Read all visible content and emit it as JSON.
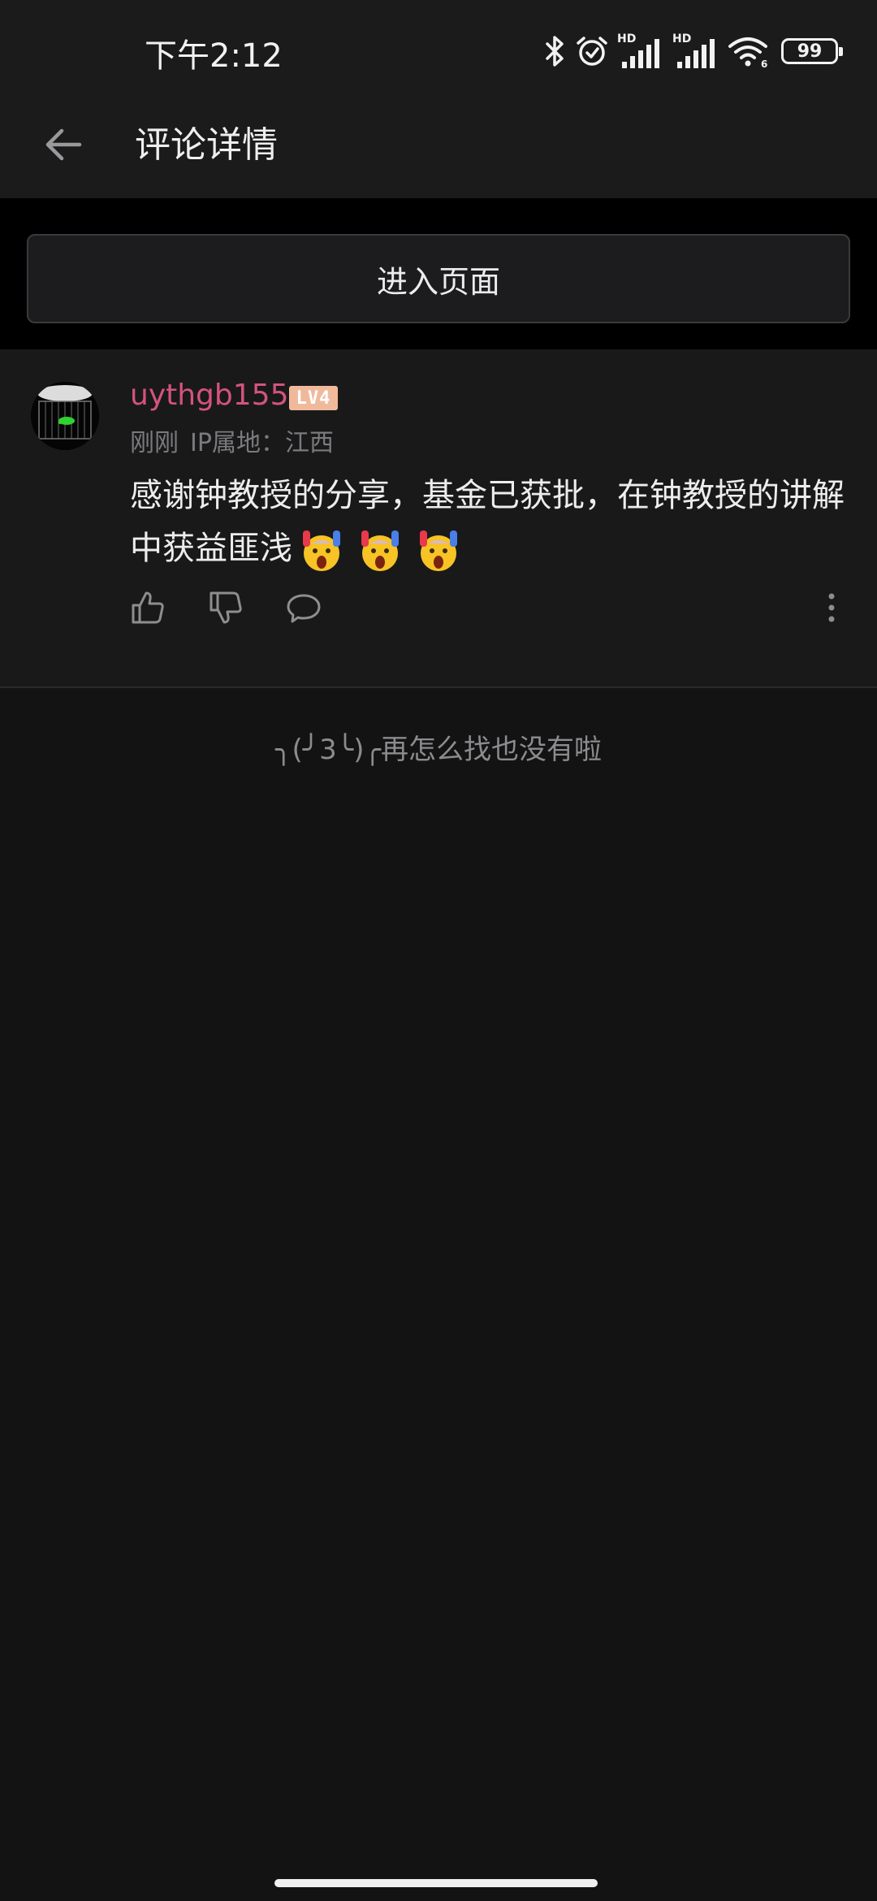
{
  "status_bar": {
    "time": "下午2:12",
    "hd_label_1": "HD",
    "hd_label_2": "HD",
    "battery_level": "99",
    "icons": [
      "bluetooth-icon",
      "alarm-icon",
      "signal-icon",
      "signal-icon",
      "wifi-icon",
      "battery-icon"
    ]
  },
  "header": {
    "title": "评论详情",
    "back_icon": "arrow-left-icon"
  },
  "enter_page": {
    "label": "进入页面"
  },
  "comment": {
    "username": "uythgb155",
    "username_color": "#d4537e",
    "level": "LV4",
    "level_color": "#f0b99b",
    "time": "刚刚",
    "ip_location": "IP属地：江西",
    "text": "感谢钟教授的分享，基金已获批，在钟教授的讲解中获益匪浅",
    "emoji": "scared-face-emoji",
    "emoji_count": 3,
    "actions": [
      "thumbs-up-icon",
      "thumbs-down-icon",
      "comment-bubble-icon",
      "more-vertical-icon"
    ]
  },
  "end_message": "╮(╯3╰)╭再怎么找也没有啦"
}
